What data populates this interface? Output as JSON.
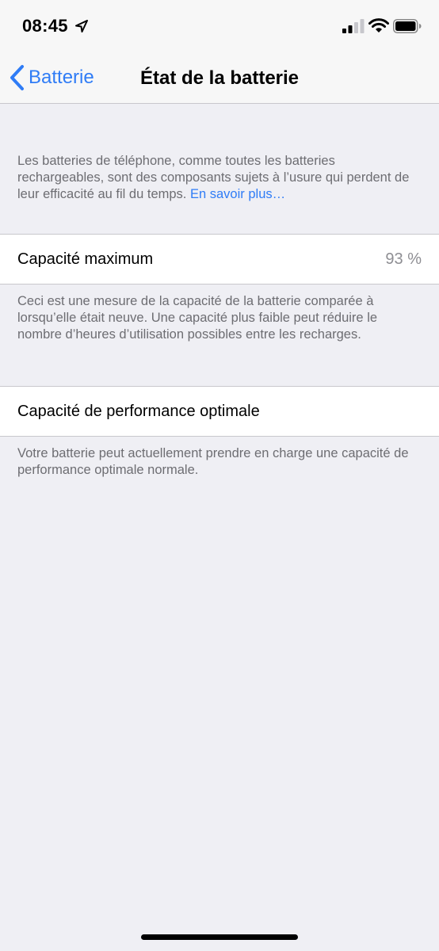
{
  "status_bar": {
    "time": "08:45",
    "icons": [
      "location-arrow-icon",
      "cellular-signal-icon",
      "wifi-icon",
      "battery-icon"
    ]
  },
  "nav": {
    "back_label": "Batterie",
    "title": "État de la batterie"
  },
  "intro": {
    "text": "Les batteries de téléphone, comme toutes les batteries rechargeables, sont des composants sujets à l’usure qui perdent de leur efficacité au fil du temps. ",
    "link": "En savoir plus…"
  },
  "max_capacity": {
    "label": "Capacité maximum",
    "value": "93 %",
    "footer": "Ceci est une mesure de la capacité de la batterie comparée à lorsqu’elle était neuve. Une capacité plus faible peut réduire le nombre d’heures d’utilisation possibles entre les recharges."
  },
  "performance": {
    "label": "Capacité de performance optimale",
    "footer": "Votre batterie peut actuellement prendre en charge une capacité de performance optimale normale."
  },
  "colors": {
    "accent": "#2f7cf6",
    "background": "#efeff4",
    "secondary_text": "#6d6d72"
  }
}
